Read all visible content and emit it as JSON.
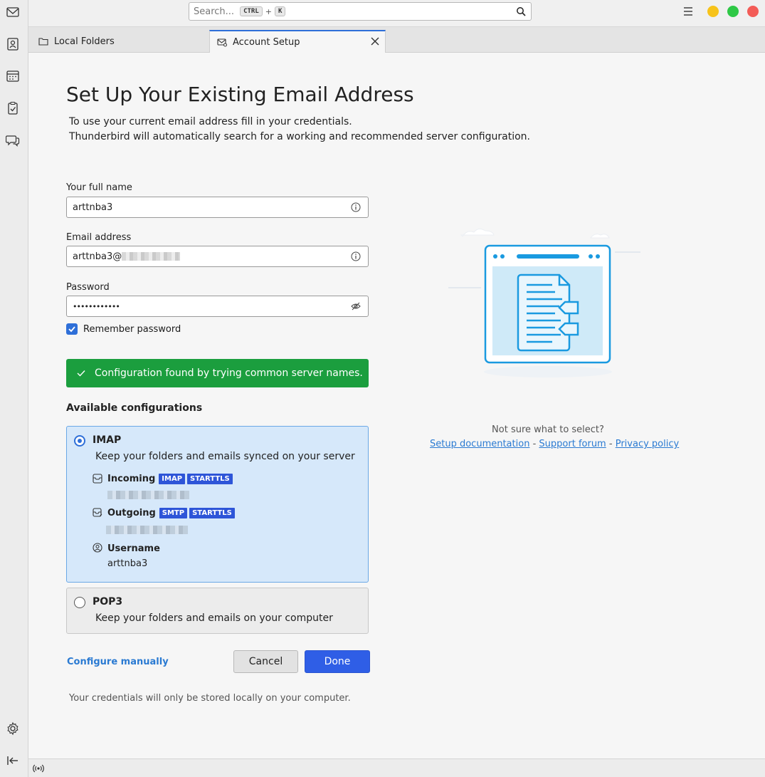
{
  "search": {
    "placeholder": "Search...",
    "key1": "CTRL",
    "plus": "+",
    "key2": "K"
  },
  "tabs": [
    {
      "label": "Local Folders"
    },
    {
      "label": "Account Setup"
    }
  ],
  "page": {
    "title": "Set Up Your Existing Email Address",
    "desc_line1": "To use your current email address fill in your credentials.",
    "desc_line2": "Thunderbird will automatically search for a working and recommended server configuration."
  },
  "form": {
    "name_label": "Your full name",
    "name_value": "arttnba3",
    "email_label": "Email address",
    "email_value": "arttnba3@",
    "password_label": "Password",
    "password_value": "••••••••••••",
    "remember_label": "Remember password"
  },
  "status": {
    "success": "Configuration found by trying common server names."
  },
  "configs": {
    "heading": "Available configurations",
    "imap": {
      "title": "IMAP",
      "desc": "Keep your folders and emails synced on your server",
      "incoming_label": "Incoming",
      "incoming_badges": [
        "IMAP",
        "STARTTLS"
      ],
      "outgoing_label": "Outgoing",
      "outgoing_badges": [
        "SMTP",
        "STARTTLS"
      ],
      "username_label": "Username",
      "username_value": "arttnba3"
    },
    "pop3": {
      "title": "POP3",
      "desc": "Keep your folders and emails on your computer"
    }
  },
  "actions": {
    "configure_manually": "Configure manually",
    "cancel": "Cancel",
    "done": "Done"
  },
  "footer_note": "Your credentials will only be stored locally on your computer.",
  "help": {
    "question": "Not sure what to select?",
    "setup_doc": "Setup documentation",
    "sep": "-",
    "support": "Support forum",
    "privacy": "Privacy policy"
  },
  "colors": {
    "accent": "#2e6fd8",
    "success": "#1b9e3e",
    "link": "#2a7ad2",
    "done_button": "#2f5ee6"
  },
  "icons": {
    "spaces": [
      "mail-icon",
      "address-book-icon",
      "calendar-icon",
      "tasks-icon",
      "chat-icon",
      "settings-icon",
      "collapse-icon"
    ]
  }
}
